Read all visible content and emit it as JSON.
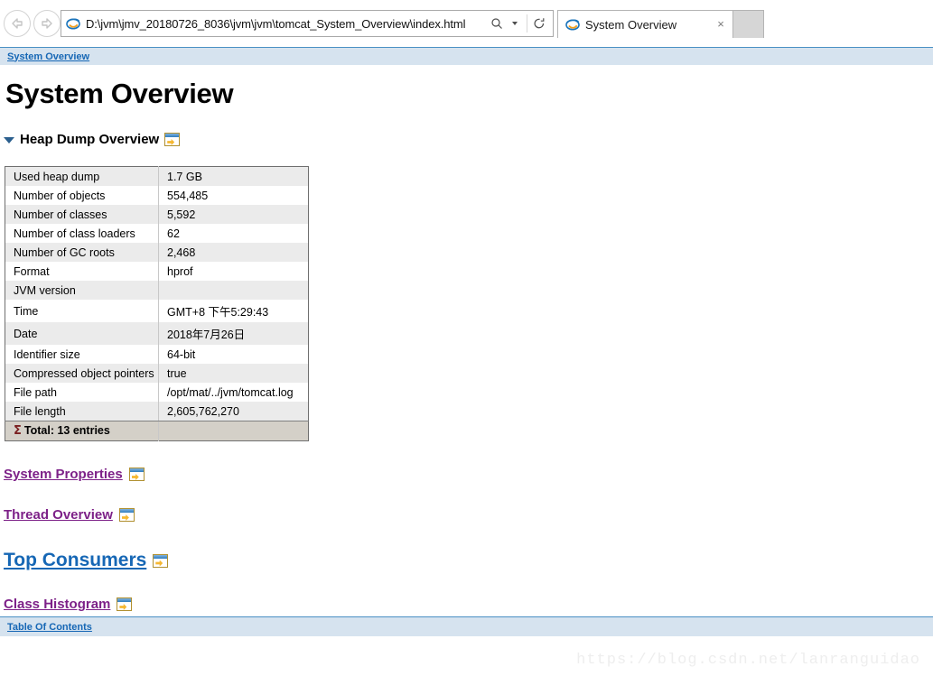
{
  "browser": {
    "back_label": "Back",
    "forward_label": "Forward",
    "url": "D:\\jvm\\jmv_20180726_8036\\jvm\\jvm\\tomcat_System_Overview\\index.html",
    "url_placeholder": "Address",
    "search_icon": "search-icon",
    "search_dropdown_icon": "chevron-down-icon",
    "refresh_icon": "refresh-icon",
    "tab": {
      "title": "System Overview",
      "favicon": "internet-explorer-icon",
      "close_label": "×"
    },
    "new_tab_label": ""
  },
  "breadcrumb": {
    "label": "System Overview"
  },
  "page": {
    "title": "System Overview",
    "section": {
      "heading": "Heap Dump Overview",
      "toggle_icon": "triangle-down-icon",
      "open_icon": "open-in-window-icon"
    }
  },
  "table": {
    "rows": [
      {
        "key": "Used heap dump",
        "value": "1.7 GB"
      },
      {
        "key": "Number of objects",
        "value": "554,485"
      },
      {
        "key": "Number of classes",
        "value": "5,592"
      },
      {
        "key": "Number of class loaders",
        "value": "62"
      },
      {
        "key": "Number of GC roots",
        "value": "2,468"
      },
      {
        "key": "Format",
        "value": "hprof"
      },
      {
        "key": "JVM version",
        "value": ""
      },
      {
        "key": "Time",
        "value": "GMT+8 下午5:29:43"
      },
      {
        "key": "Date",
        "value": "2018年7月26日"
      },
      {
        "key": "Identifier size",
        "value": "64-bit"
      },
      {
        "key": "Compressed object pointers",
        "value": "true"
      },
      {
        "key": "File path",
        "value": "/opt/mat/../jvm/tomcat.log"
      },
      {
        "key": "File length",
        "value": "2,605,762,270"
      }
    ],
    "total_sigma": "Σ",
    "total_label": "Total: 13 entries",
    "total_value": ""
  },
  "links": {
    "system_properties": "System Properties",
    "thread_overview": "Thread Overview",
    "top_consumers": "Top Consumers",
    "class_histogram": "Class Histogram"
  },
  "footer": {
    "table_of_contents": "Table Of Contents"
  },
  "watermark": "https://blog.csdn.net/lanranguidao",
  "colors": {
    "breadcrumb_bg": "#d6e3ef",
    "breadcrumb_border": "#4a90c4",
    "link_blue": "#1667b5",
    "link_purple": "#7d2188",
    "row_stripe": "#ebebeb",
    "total_row_bg": "#d4d0c8",
    "sigma_red": "#7a1f1f"
  }
}
